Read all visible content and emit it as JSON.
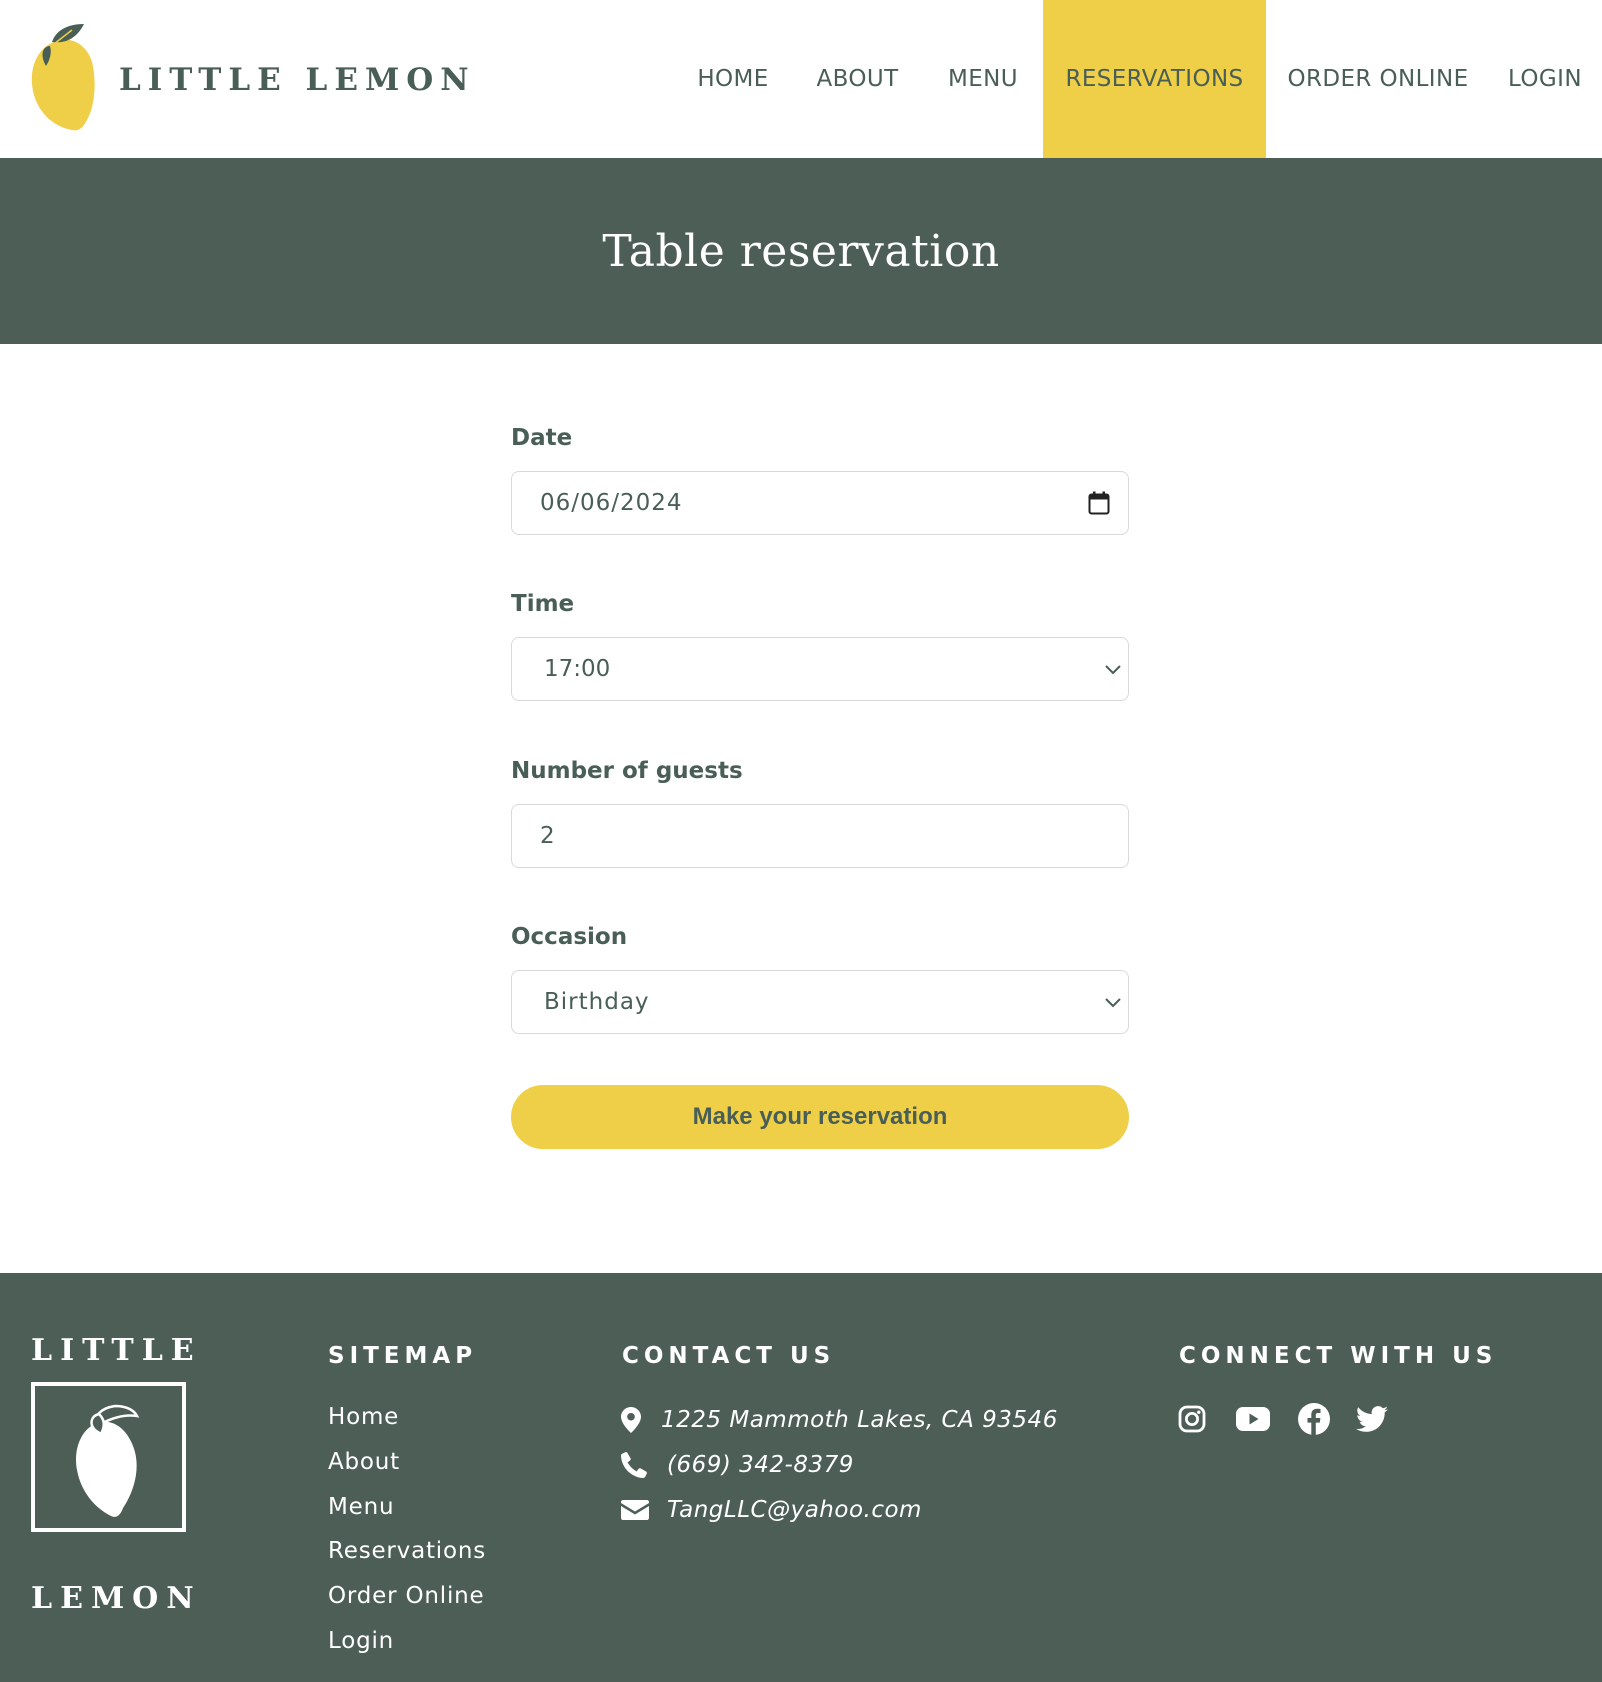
{
  "brand": {
    "name": "LITTLE LEMON",
    "footer_top": "LITTLE",
    "footer_bottom": "LEMON"
  },
  "nav": {
    "items": [
      {
        "label": "HOME"
      },
      {
        "label": "ABOUT"
      },
      {
        "label": "MENU"
      },
      {
        "label": "RESERVATIONS",
        "active": true
      },
      {
        "label": "ORDER ONLINE"
      },
      {
        "label": "LOGIN"
      }
    ]
  },
  "hero": {
    "title": "Table reservation"
  },
  "form": {
    "date": {
      "label": "Date",
      "value": "06/06/2024"
    },
    "time": {
      "label": "Time",
      "value": "17:00"
    },
    "guests": {
      "label": "Number of guests",
      "value": "2"
    },
    "occasion": {
      "label": "Occasion",
      "value": "Birthday"
    },
    "submit_label": "Make your reservation"
  },
  "footer": {
    "sitemap": {
      "heading": "SITEMAP",
      "links": [
        "Home",
        "About",
        "Menu",
        "Reservations",
        "Order Online",
        "Login"
      ]
    },
    "contact": {
      "heading": "CONTACT US",
      "address": "1225 Mammoth Lakes, CA 93546",
      "phone": "(669) 342-8379",
      "email": "TangLLC@yahoo.com"
    },
    "connect": {
      "heading": "CONNECT WITH US",
      "icons": [
        "instagram-icon",
        "youtube-icon",
        "facebook-icon",
        "twitter-icon"
      ]
    }
  },
  "colors": {
    "primary_green": "#495e57",
    "hero_green": "#4d5e57",
    "accent_yellow": "#eecf47",
    "white": "#ffffff"
  }
}
